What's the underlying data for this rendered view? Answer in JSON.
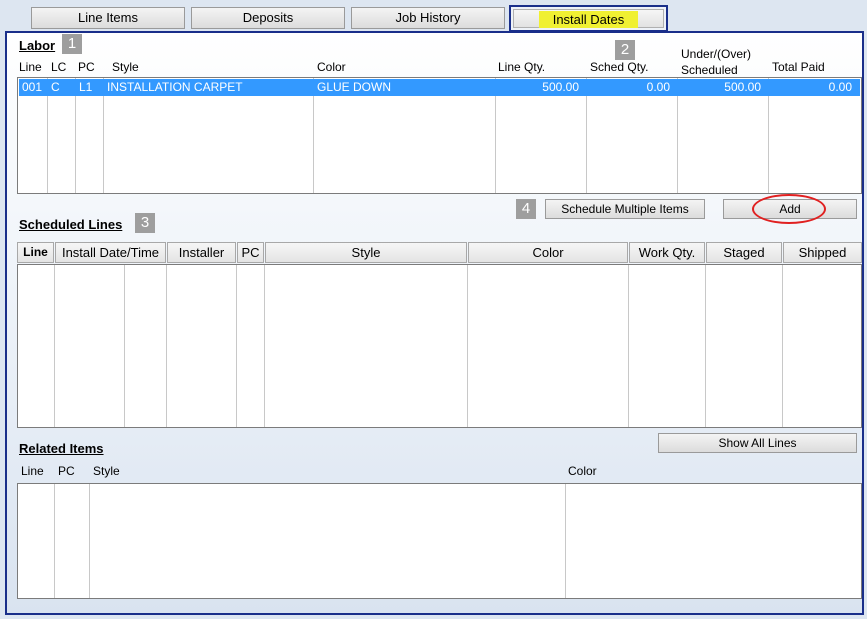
{
  "tabs": [
    "Line Items",
    "Deposits",
    "Job History",
    "Install Dates"
  ],
  "labor": {
    "title": "Labor",
    "badges": [
      "1",
      "2"
    ],
    "columns": [
      "Line",
      "LC",
      "PC",
      "Style",
      "Color",
      "Line Qty.",
      "Sched Qty.",
      "Under/(Over)",
      "Scheduled",
      "Total Paid"
    ],
    "row": {
      "line": "001",
      "lc": "C",
      "pc": "L1",
      "style": "INSTALLATION CARPET",
      "color": "GLUE DOWN",
      "line_qty": "500.00",
      "sched_qty": "0.00",
      "under_over": "500.00",
      "total_paid": "0.00"
    }
  },
  "actions": {
    "badge": "4",
    "schedule_multiple": "Schedule Multiple Items",
    "add": "Add"
  },
  "scheduled": {
    "title": "Scheduled Lines",
    "badge": "3",
    "columns": [
      "Line",
      "Install Date/Time",
      "Installer",
      "PC",
      "Style",
      "Color",
      "Work Qty.",
      "Staged",
      "Shipped"
    ]
  },
  "related": {
    "title": "Related Items",
    "show_all": "Show All Lines",
    "columns": [
      "Line",
      "PC",
      "Style",
      "Color"
    ]
  },
  "colors": {
    "selection": "#3399ff",
    "frame": "#1a2f8a",
    "tab_highlight": "#f0f032",
    "annotation": "#e02020"
  }
}
